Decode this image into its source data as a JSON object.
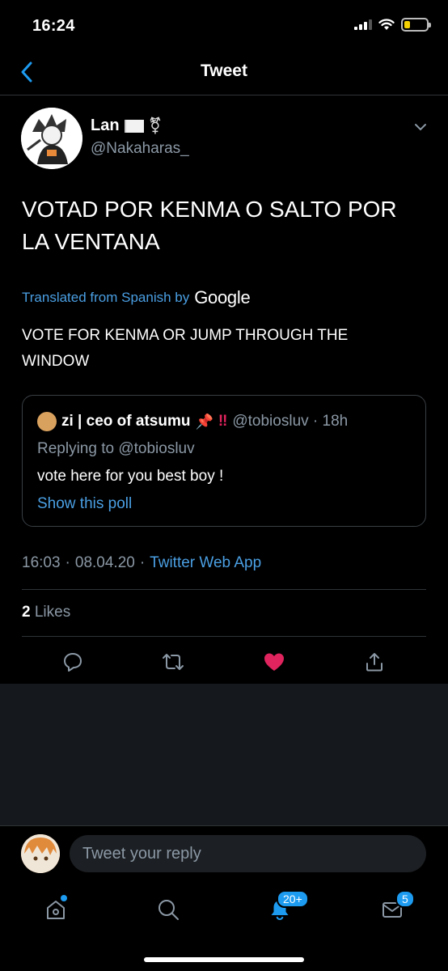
{
  "status_bar": {
    "time": "16:24"
  },
  "nav": {
    "title": "Tweet"
  },
  "tweet": {
    "author_name": "Lan",
    "author_handle": "@Nakaharas_",
    "text": "VOTAD POR KENMA O SALTO POR LA VENTANA",
    "translated_label": "Translated from Spanish by",
    "translator": "Google",
    "translation": "VOTE FOR KENMA OR JUMP THROUGH THE WINDOW",
    "quote": {
      "name": "zi | ceo of atsumu",
      "handle_time": "@tobiosluv · 18h",
      "reply_to": "Replying to @tobiosluv",
      "text": "vote here for you best boy !",
      "poll_link": "Show this poll"
    },
    "time": "16:03",
    "date": "08.04.20",
    "source": "Twitter Web App",
    "like_count": "2",
    "likes_label": "Likes"
  },
  "reply": {
    "placeholder": "Tweet your reply"
  },
  "tabs": {
    "notifications_badge": "20+",
    "messages_badge": "5"
  },
  "colors": {
    "accent": "#1d9bf0",
    "like": "#e0245e",
    "link": "#4a9fe3"
  },
  "icons": [
    "back-chevron-icon",
    "chevron-down-icon",
    "reply-icon",
    "retweet-icon",
    "heart-icon",
    "share-icon",
    "home-icon",
    "search-icon",
    "notifications-icon",
    "messages-icon"
  ]
}
